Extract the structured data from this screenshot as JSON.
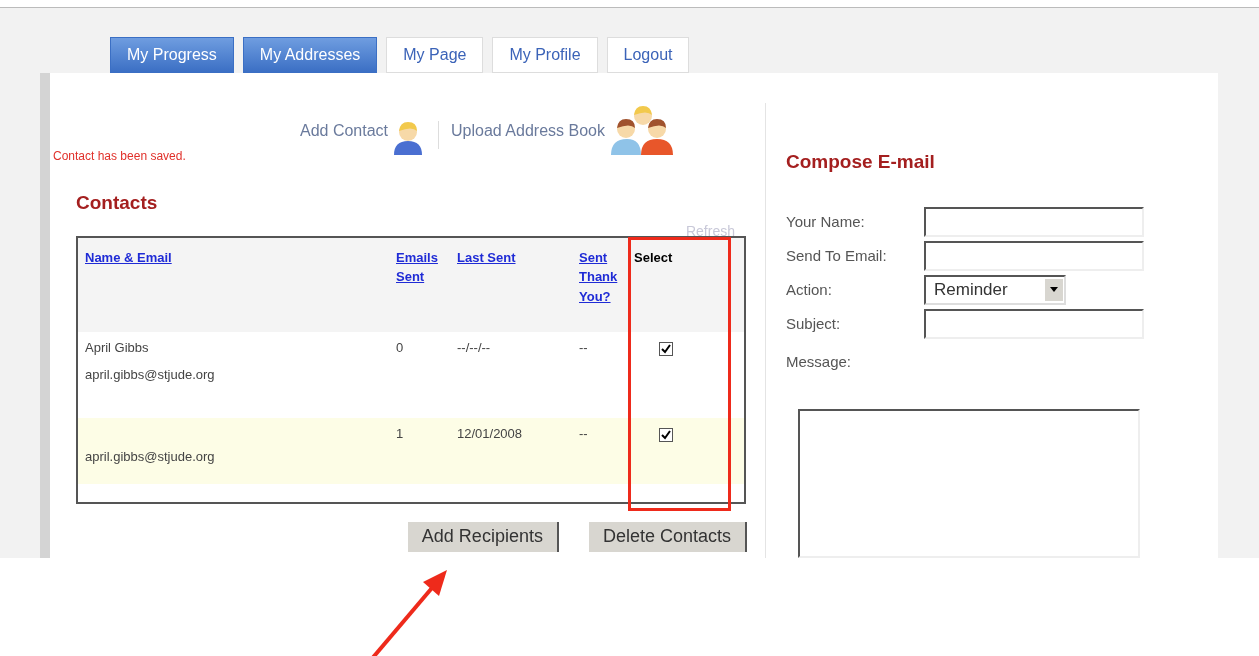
{
  "tabs": [
    {
      "label": "My Progress",
      "selected": true
    },
    {
      "label": "My Addresses",
      "selected": true
    },
    {
      "label": "My Page",
      "selected": false
    },
    {
      "label": "My Profile",
      "selected": false
    },
    {
      "label": "Logout",
      "selected": false
    }
  ],
  "actions": [
    {
      "label": "Add Contact",
      "kind": "person"
    },
    {
      "label": "Upload Address Book",
      "kind": "group"
    }
  ],
  "status_message": "Contact has been saved.",
  "contacts": {
    "title": "Contacts",
    "refresh": "Refresh",
    "columns": [
      "Name & Email",
      "Emails Sent",
      "Last Sent",
      "Sent Thank You?",
      "Select"
    ],
    "rows": [
      {
        "name": "April Gibbs",
        "email": "april.gibbs@stjude.org",
        "emails_sent": "0",
        "last_sent": "--/--/--",
        "sent_thank_you": "--",
        "checked": true
      },
      {
        "email": "april.gibbs@stjude.org",
        "emails_sent": "1",
        "last_sent": "12/01/2008",
        "sent_thank_you": "--",
        "checked": true
      }
    ]
  },
  "buttons": [
    "Add Recipients",
    "Delete Contacts"
  ],
  "compose": {
    "title": "Compose E-mail",
    "fields": [
      {
        "label": "Your Name:",
        "kind": "text"
      },
      {
        "label": "Send To Email:",
        "kind": "text"
      },
      {
        "label": "Action:",
        "kind": "select",
        "value": "Reminder"
      },
      {
        "label": "Subject:",
        "kind": "text"
      }
    ],
    "message_label": "Message:"
  }
}
